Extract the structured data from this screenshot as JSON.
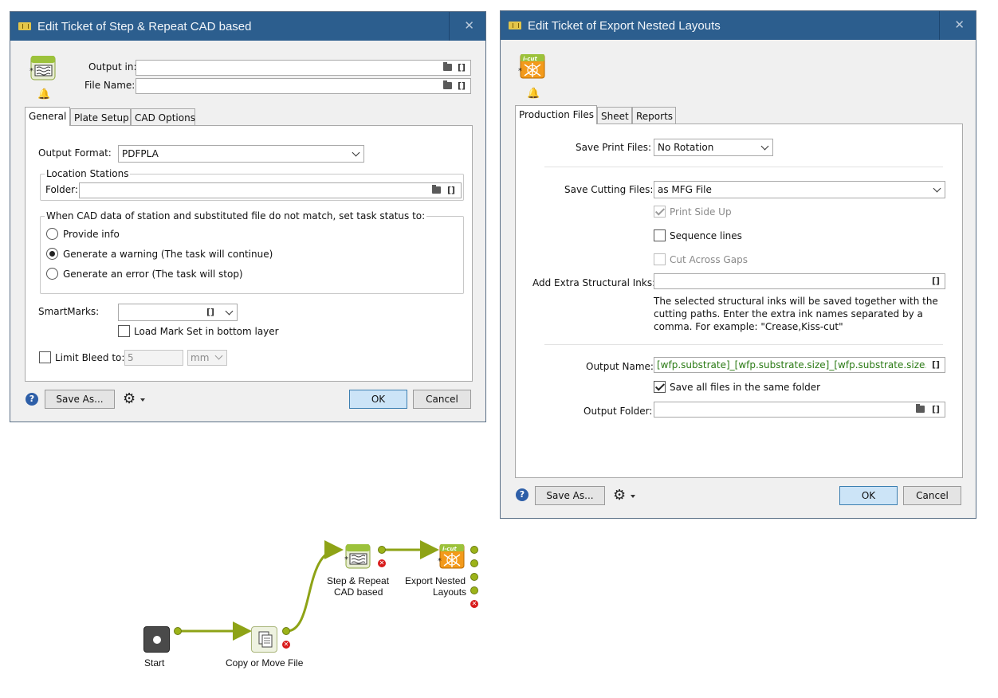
{
  "dialog1": {
    "title": "Edit Ticket of Step & Repeat CAD based",
    "output_in_label": "Output in:",
    "output_in_value": "",
    "file_name_label": "File Name:",
    "file_name_value": "",
    "bracket": "[]",
    "tabs": [
      "General",
      "Plate Setup",
      "CAD Options"
    ],
    "output_format_label": "Output Format:",
    "output_format_value": "PDFPLA",
    "location_group": "Location Stations",
    "folder_label": "Folder:",
    "folder_value": "",
    "mismatch_group": "When CAD data of station and substituted file do not match, set task status to:",
    "radio_options": [
      "Provide info",
      "Generate a warning (The task will continue)",
      "Generate an error (The task will stop)"
    ],
    "radio_selected": 1,
    "smartmarks_label": "SmartMarks:",
    "smartmarks_value": "",
    "load_mark_set": "Load Mark Set in bottom layer",
    "limit_bleed": "Limit Bleed to:",
    "bleed_value": "5",
    "bleed_unit": "mm",
    "save_as": "Save As...",
    "ok": "OK",
    "cancel": "Cancel"
  },
  "dialog2": {
    "title": "Edit Ticket of Export Nested Layouts",
    "tabs": [
      "Production Files",
      "Sheet",
      "Reports"
    ],
    "save_print_label": "Save Print Files:",
    "save_print_value": "No Rotation",
    "save_cutting_label": "Save Cutting Files:",
    "save_cutting_value": "as MFG File",
    "print_side_up": "Print Side Up",
    "sequence_lines": "Sequence lines",
    "cut_across_gaps": "Cut Across Gaps",
    "extra_inks_label": "Add Extra Structural Inks:",
    "extra_inks_value": "",
    "help_line1": "The selected structural inks will be saved together with the",
    "help_line2": "cutting paths. Enter the extra ink names separated by a",
    "help_line3": "comma. For example: \"Crease,Kiss-cut\"",
    "output_name_label": "Output Name:",
    "output_name_value": "[wfp.substrate]_[wfp.substrate.size]_[wfp.substrate.size.q",
    "save_same_folder": "Save all files in the same folder",
    "output_folder_label": "Output Folder:",
    "output_folder_value": "",
    "bracket": "[]",
    "save_as": "Save As...",
    "ok": "OK",
    "cancel": "Cancel",
    "icu_badge": "i-cut"
  },
  "workflow": {
    "start": "Start",
    "copy_line1": "Copy or Move File",
    "step_line1": "Step & Repeat",
    "step_line2": "CAD based",
    "export_line1": "Export Nested",
    "export_line2": "Layouts"
  },
  "colors": {
    "titlebar": "#2c5e8e",
    "connector": "#9cb319",
    "error": "#d81b1b",
    "green_text": "#2a7a14"
  }
}
